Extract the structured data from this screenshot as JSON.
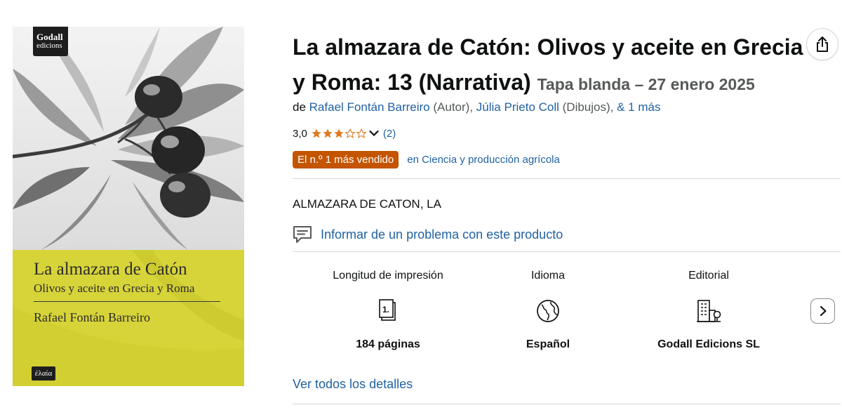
{
  "cover": {
    "publisher_logo_line1": "Godall",
    "publisher_logo_line2": "edicions",
    "title": "La almazara de Catón",
    "subtitle": "Olivos y aceite en Grecia y Roma",
    "author": "Rafael Fontán Barreiro",
    "series_badge": "ἐλαία",
    "band_color": "#d7d43a"
  },
  "product": {
    "title": "La almazara de Catón: Olivos y aceite en Grecia y Roma: 13 (Narrativa)",
    "binding_date": "Tapa blanda – 27 enero 2025",
    "by_prefix": "de",
    "contributors": [
      {
        "name": "Rafael Fontán Barreiro",
        "role": "(Autor),",
        "separator": " "
      },
      {
        "name": "Júlia Prieto Coll",
        "role": "(Dibujos),",
        "separator": " "
      }
    ],
    "more_authors": "& 1 más",
    "rating_value": "3,0",
    "rating_stars": 3,
    "rating_max": 5,
    "rating_count": "(2)",
    "star_color": "#de7921",
    "bestseller_badge": "El n.º 1 más vendido",
    "bestseller_badge_color": "#c45500",
    "bestseller_category": "en Ciencia y producción agrícola",
    "short_title": "ALMAZARA DE CATON, LA",
    "report_link": "Informar de un problema con este producto",
    "link_color": "#2162a1"
  },
  "attributes": [
    {
      "label": "Longitud de impresión",
      "icon": "pages-icon",
      "value": "184 páginas"
    },
    {
      "label": "Idioma",
      "icon": "globe-icon",
      "value": "Español"
    },
    {
      "label": "Editorial",
      "icon": "building-icon",
      "value": "Godall Edicions SL"
    }
  ],
  "see_all_details": "Ver todos los detalles",
  "share_icon": "share-icon",
  "next_icon": "chevron-right-icon"
}
